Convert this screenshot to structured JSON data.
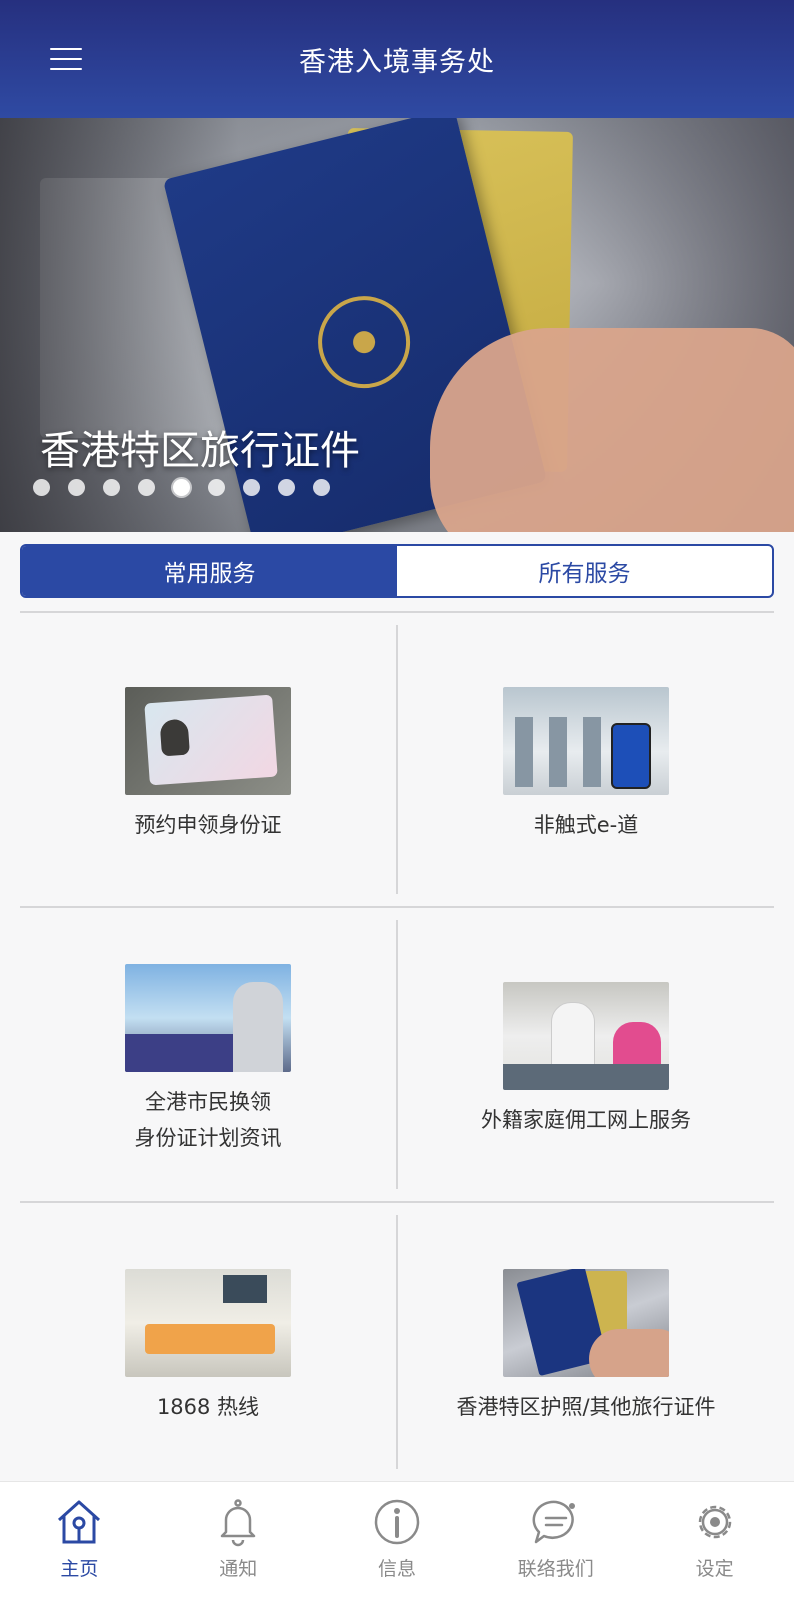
{
  "header": {
    "title": "香港入境事务处",
    "menu_icon": "hamburger-menu-icon"
  },
  "banner": {
    "caption": "香港特区旅行证件",
    "slide_count": 9,
    "active_slide_index": 4
  },
  "tabs": [
    {
      "label": "常用服务",
      "active": true
    },
    {
      "label": "所有服务",
      "active": false
    }
  ],
  "services": [
    {
      "label": "预约申领身份证",
      "image": "id-card-photo"
    },
    {
      "label": "非触式e-道",
      "image": "e-channel-photo"
    },
    {
      "label": "全港市民换领\n身份证计划资讯",
      "image": "id-replacement-campaign-photo"
    },
    {
      "label": "外籍家庭佣工网上服务",
      "image": "counter-service-photo"
    },
    {
      "label": "1868 热线",
      "image": "call-centre-photo"
    },
    {
      "label": "香港特区护照/其他旅行证件",
      "image": "passport-photo"
    }
  ],
  "bottom_nav": [
    {
      "label": "主页",
      "icon": "home-icon",
      "active": true
    },
    {
      "label": "通知",
      "icon": "bell-icon",
      "active": false
    },
    {
      "label": "信息",
      "icon": "info-icon",
      "active": false
    },
    {
      "label": "联络我们",
      "icon": "chat-bubble-icon",
      "active": false
    },
    {
      "label": "设定",
      "icon": "gear-icon",
      "active": false
    }
  ],
  "colors": {
    "header_start": "#26307f",
    "header_end": "#2f4aa3",
    "accent": "#2b49a4",
    "inactive_nav": "#8a8a8a"
  }
}
